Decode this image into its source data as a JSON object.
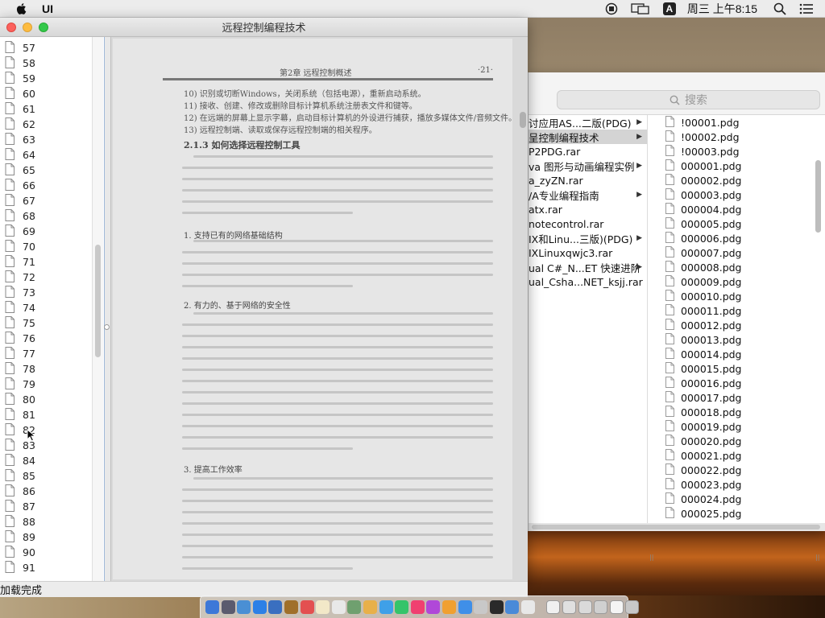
{
  "menubar": {
    "app_name": "UI",
    "ime_label": "A",
    "clock": "周三 上午8:15"
  },
  "reader": {
    "title": "远程控制编程技术",
    "status": "加载完成",
    "page_list": [
      "57",
      "58",
      "59",
      "60",
      "61",
      "62",
      "63",
      "64",
      "65",
      "66",
      "67",
      "68",
      "69",
      "70",
      "71",
      "72",
      "73",
      "74",
      "75",
      "76",
      "77",
      "78",
      "79",
      "80",
      "81",
      "82",
      "83",
      "84",
      "85",
      "86",
      "87",
      "88",
      "89",
      "90",
      "91"
    ],
    "doc": {
      "header_left": "第2章  远程控制概述",
      "header_right": "·21·",
      "lines": [
        "10) 识别或切断Windows，关闭系统（包括电源），重新启动系统。",
        "11) 接收、创建、修改或删除目标计算机系统注册表文件和键等。",
        "12) 在远端的屏幕上显示字幕，启动目标计算机的外设进行捕获，播放多媒体文件/音频文件。",
        "13) 远程控制端、读取或保存远程控制端的相关程序。"
      ],
      "h_213": "2.1.3   如何选择远程控制工具",
      "h_1": "1. 支持已有的网络基础结构",
      "h_2": "2. 有力的、基于网络的安全性",
      "h_3": "3. 提高工作效率"
    }
  },
  "finder": {
    "search_placeholder": "搜索",
    "col1": [
      {
        "label": "讨应用AS...二版(PDG)",
        "arrow": true,
        "selected": false
      },
      {
        "label": "呈控制编程技术",
        "arrow": true,
        "selected": true
      },
      {
        "label": "P2PDG.rar",
        "arrow": false,
        "selected": false
      },
      {
        "label": "va 图形与动画编程实例",
        "arrow": true,
        "selected": false
      },
      {
        "label": "a_zyZN.rar",
        "arrow": false,
        "selected": false
      },
      {
        "label": "/A专业编程指南",
        "arrow": true,
        "selected": false
      },
      {
        "label": "atx.rar",
        "arrow": false,
        "selected": false
      },
      {
        "label": "notecontrol.rar",
        "arrow": false,
        "selected": false
      },
      {
        "label": "IX和Linu...三版)(PDG)",
        "arrow": true,
        "selected": false
      },
      {
        "label": "IXLinuxqwjc3.rar",
        "arrow": false,
        "selected": false
      },
      {
        "label": "ual C#_N...ET 快速进阶",
        "arrow": true,
        "selected": false
      },
      {
        "label": "ual_Csha...NET_ksjj.rar",
        "arrow": false,
        "selected": false
      }
    ],
    "col2": [
      "!00001.pdg",
      "!00002.pdg",
      "!00003.pdg",
      "000001.pdg",
      "000002.pdg",
      "000003.pdg",
      "000004.pdg",
      "000005.pdg",
      "000006.pdg",
      "000007.pdg",
      "000008.pdg",
      "000009.pdg",
      "000010.pdg",
      "000011.pdg",
      "000012.pdg",
      "000013.pdg",
      "000014.pdg",
      "000015.pdg",
      "000016.pdg",
      "000017.pdg",
      "000018.pdg",
      "000019.pdg",
      "000020.pdg",
      "000021.pdg",
      "000022.pdg",
      "000023.pdg",
      "000024.pdg",
      "000025.pdg"
    ]
  },
  "dock": {
    "icon_colors": [
      "#3d78d8",
      "#5b5b6e",
      "#4a8fd4",
      "#2d80e6",
      "#3a6fc0",
      "#a0702a",
      "#e35050",
      "#f2e8c8",
      "#e8e8e8",
      "#6fa06f",
      "#e8b04a",
      "#3fa0e8",
      "#35c46a",
      "#f04070",
      "#b048d8",
      "#f0a030",
      "#3f8fe8",
      "#c8c8c8",
      "#2a2a2a",
      "#4a8ad8",
      "#e8e8e8"
    ],
    "right_icon_colors": [
      "#f0f0f0",
      "#e0e0e0",
      "#dadada",
      "#d0d0d0",
      "#f4f4f4",
      "#c8c8c8"
    ]
  }
}
